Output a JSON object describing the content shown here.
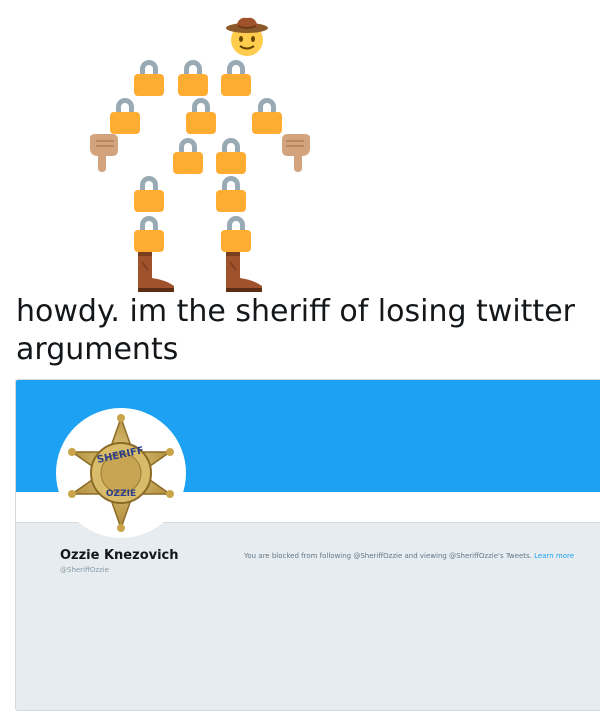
{
  "caption": "howdy. im the sheriff of losing twitter arguments",
  "profile": {
    "name": "Ozzie Knezovich",
    "handle": "@SheriffOzzie",
    "blocked_text": "You are blocked from following @SheriffOzzie and viewing @SheriffOzzie's Tweets.",
    "learn_more": "Learn more",
    "badge_top": "SHERIFF",
    "badge_bottom": "OZZIE"
  },
  "colors": {
    "banner": "#1da1f2",
    "lock_body": "#ffac33",
    "lock_shackle": "#99aab5",
    "card_bg": "#e6ecf0",
    "badge_gold": "#c9a44a"
  },
  "icons": [
    "cowboy-face-icon",
    "lock-icon",
    "pointing-down-hand-icon",
    "cowboy-boot-icon",
    "sheriff-star-badge-icon"
  ]
}
